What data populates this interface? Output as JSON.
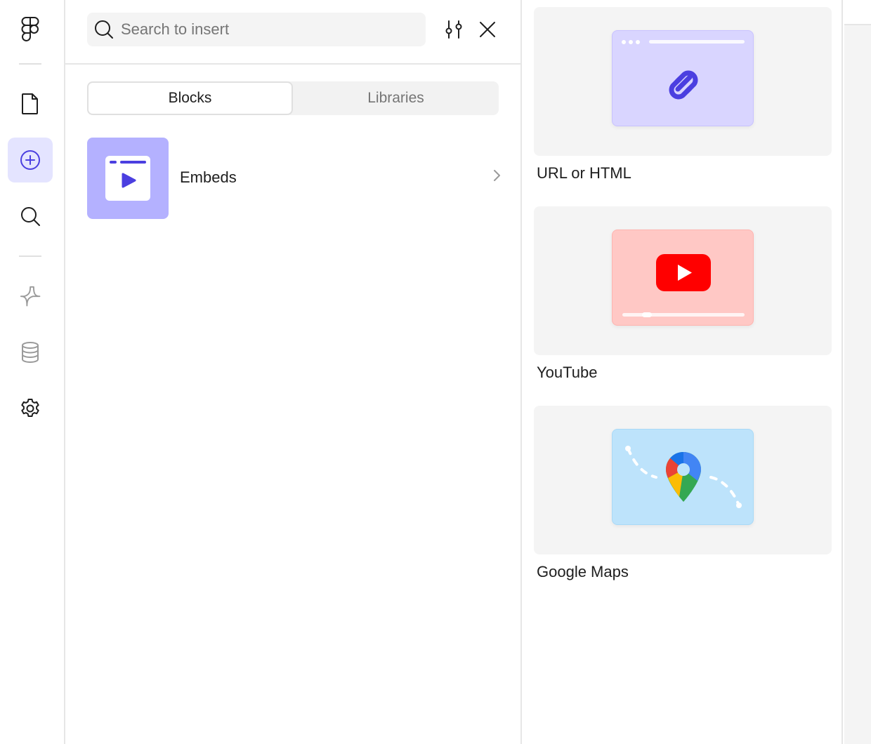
{
  "rail": {
    "items": [
      {
        "icon": "figma-logo-icon"
      },
      {
        "icon": "file-icon"
      },
      {
        "icon": "insert-plus-icon",
        "active": true
      },
      {
        "icon": "search-icon"
      },
      {
        "icon": "components-icon"
      },
      {
        "icon": "database-icon"
      },
      {
        "icon": "settings-gear-icon"
      }
    ]
  },
  "panel": {
    "search": {
      "placeholder": "Search to insert",
      "value": ""
    },
    "tabs": [
      {
        "label": "Blocks",
        "active": true
      },
      {
        "label": "Libraries",
        "active": false
      }
    ],
    "rows": [
      {
        "label": "Embeds",
        "icon": "embeds-video-icon"
      }
    ]
  },
  "embeds": {
    "cards": [
      {
        "label": "URL or HTML",
        "icon": "link-icon",
        "bg": "#d9d5ff"
      },
      {
        "label": "YouTube",
        "icon": "youtube-icon",
        "bg": "#ffc8c5"
      },
      {
        "label": "Google Maps",
        "icon": "google-maps-pin-icon",
        "bg": "#bde3fb"
      }
    ]
  },
  "colors": {
    "accent": "#4b3fe0",
    "active_rail_bg": "#e4e4ff",
    "thumb_bg": "#b4b1ff",
    "youtube_red": "#ff0000"
  }
}
